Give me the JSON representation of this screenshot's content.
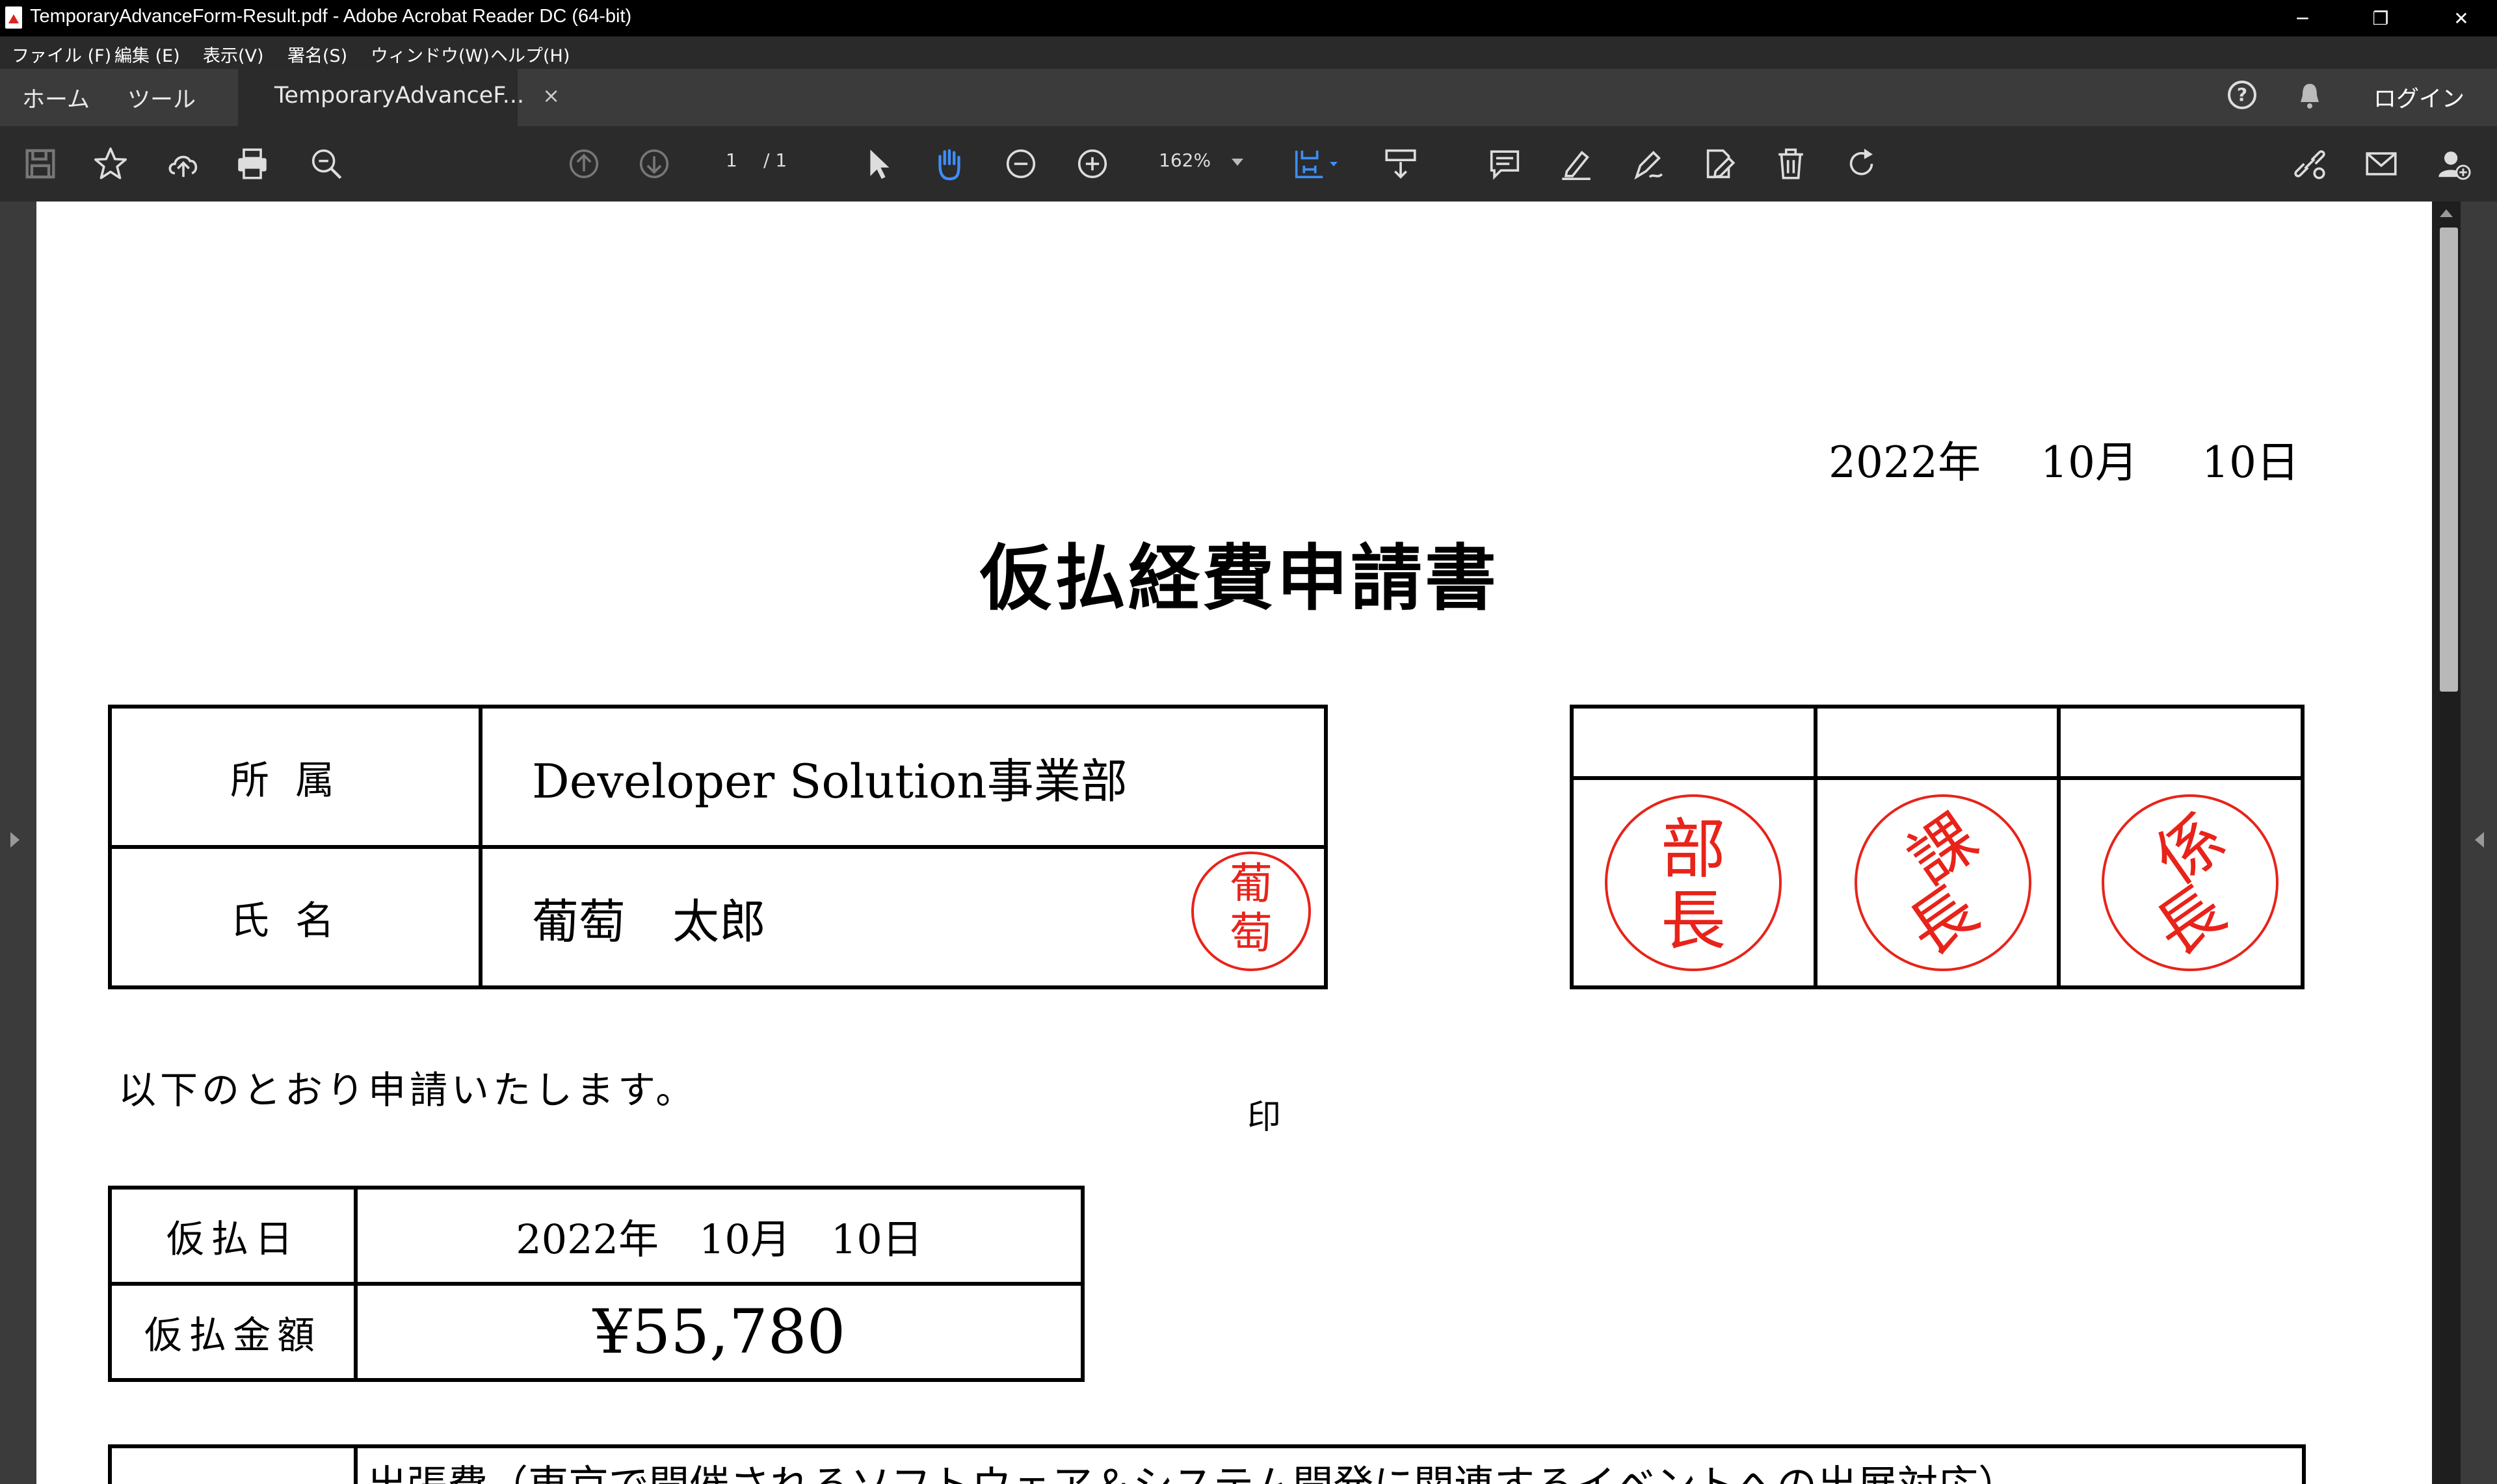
{
  "window": {
    "title": "TemporaryAdvanceForm-Result.pdf - Adobe Acrobat Reader DC (64-bit)",
    "minimize": "─",
    "restore": "❐",
    "close": "✕"
  },
  "menu": {
    "items": [
      "ファイル (F)",
      "編集 (E)",
      "表示(V)",
      "署名(S)",
      "ウィンドウ(W)",
      "ヘルプ(H)"
    ]
  },
  "tabs": {
    "home": "ホーム",
    "tools": "ツール",
    "document": "TemporaryAdvanceF...",
    "close": "×",
    "login": "ログイン",
    "help": "?"
  },
  "toolbar": {
    "page_current": "1",
    "page_total": "/ 1",
    "zoom": "162%",
    "accent": "#3e8ef7"
  },
  "document": {
    "date": {
      "year": "2022年",
      "month": "10月",
      "day": "10日"
    },
    "title": "仮払経費申請書",
    "affiliation_label": "所属",
    "affiliation_value": "Developer Solution事業部",
    "name_label": "氏名",
    "name_value": "葡萄　太郎",
    "seal_mark": "印",
    "personal_seal": [
      "葡",
      "萄"
    ],
    "approval_stamps": [
      {
        "chars": [
          "部",
          "長"
        ]
      },
      {
        "chars": [
          "課",
          "長"
        ]
      },
      {
        "chars": [
          "係",
          "長"
        ]
      }
    ],
    "stamp_color": "#e8231a",
    "intro": "以下のとおり申請いたします。",
    "advance_date_label": "仮払日",
    "advance_date_value": "2022年　10月　10日",
    "advance_amount_label": "仮払金額",
    "advance_amount_value": "¥55,780",
    "purpose_value": "出張費（東京で開催されるソフトウェア＆システム開発に関連するイベントへの出展対応）"
  }
}
